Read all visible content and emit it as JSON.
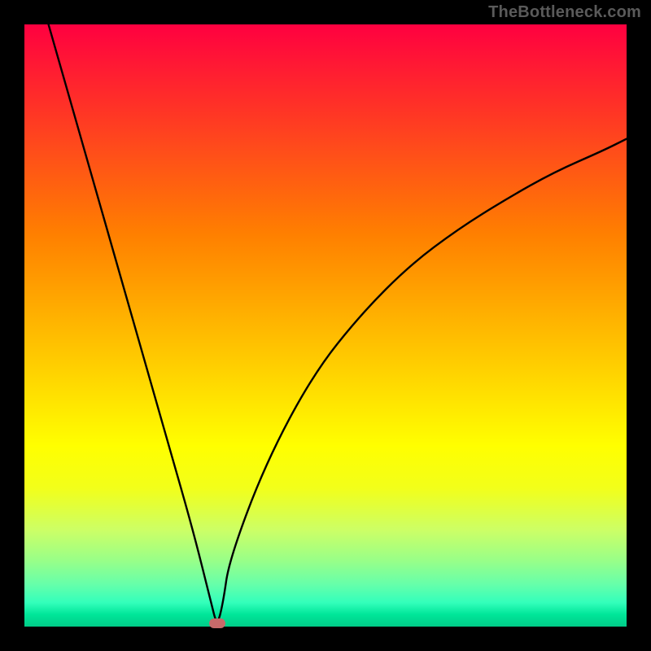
{
  "watermark": "TheBottleneck.com",
  "chart_data": {
    "type": "line",
    "title": "",
    "xlabel": "",
    "ylabel": "",
    "xlim": [
      0,
      100
    ],
    "ylim": [
      0,
      100
    ],
    "grid": false,
    "legend": false,
    "series": [
      {
        "name": "bottleneck-curve",
        "x": [
          4,
          8,
          12,
          16,
          20,
          24,
          28,
          31,
          32,
          33,
          34,
          40,
          48,
          56,
          64,
          72,
          80,
          88,
          96,
          100
        ],
        "y": [
          100,
          86,
          72,
          58,
          44,
          30,
          16,
          4,
          0,
          4,
          11,
          27,
          42,
          52,
          60,
          66,
          71,
          75.5,
          79,
          81
        ]
      }
    ],
    "marker": {
      "x": 32,
      "y": 0.5,
      "name": "optimal-point"
    },
    "background_gradient": {
      "top": "#ff0040",
      "bottom": "#00cc88"
    }
  }
}
